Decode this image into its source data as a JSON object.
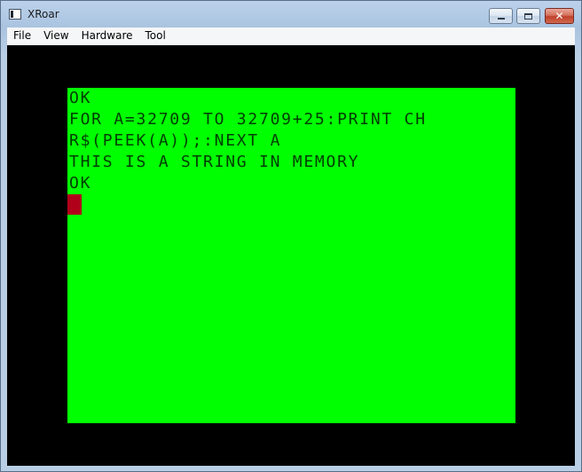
{
  "window": {
    "title": "XRoar",
    "icon": "xroar-app-icon",
    "controls": {
      "minimize_icon": "minimize-icon",
      "maximize_icon": "maximize-icon",
      "close_glyph": "✕"
    }
  },
  "menubar": {
    "items": [
      {
        "label": "File"
      },
      {
        "label": "View"
      },
      {
        "label": "Hardware"
      },
      {
        "label": "Tool"
      }
    ]
  },
  "screen": {
    "background_color": "#00ff00",
    "text_color": "#003d00",
    "cursor_color": "#b0001a",
    "lines": [
      "OK",
      "FOR A=32709 TO 32709+25:PRINT CH",
      "R$(PEEK(A));:NEXT A",
      "THIS IS A STRING IN MEMORY",
      "OK"
    ]
  }
}
